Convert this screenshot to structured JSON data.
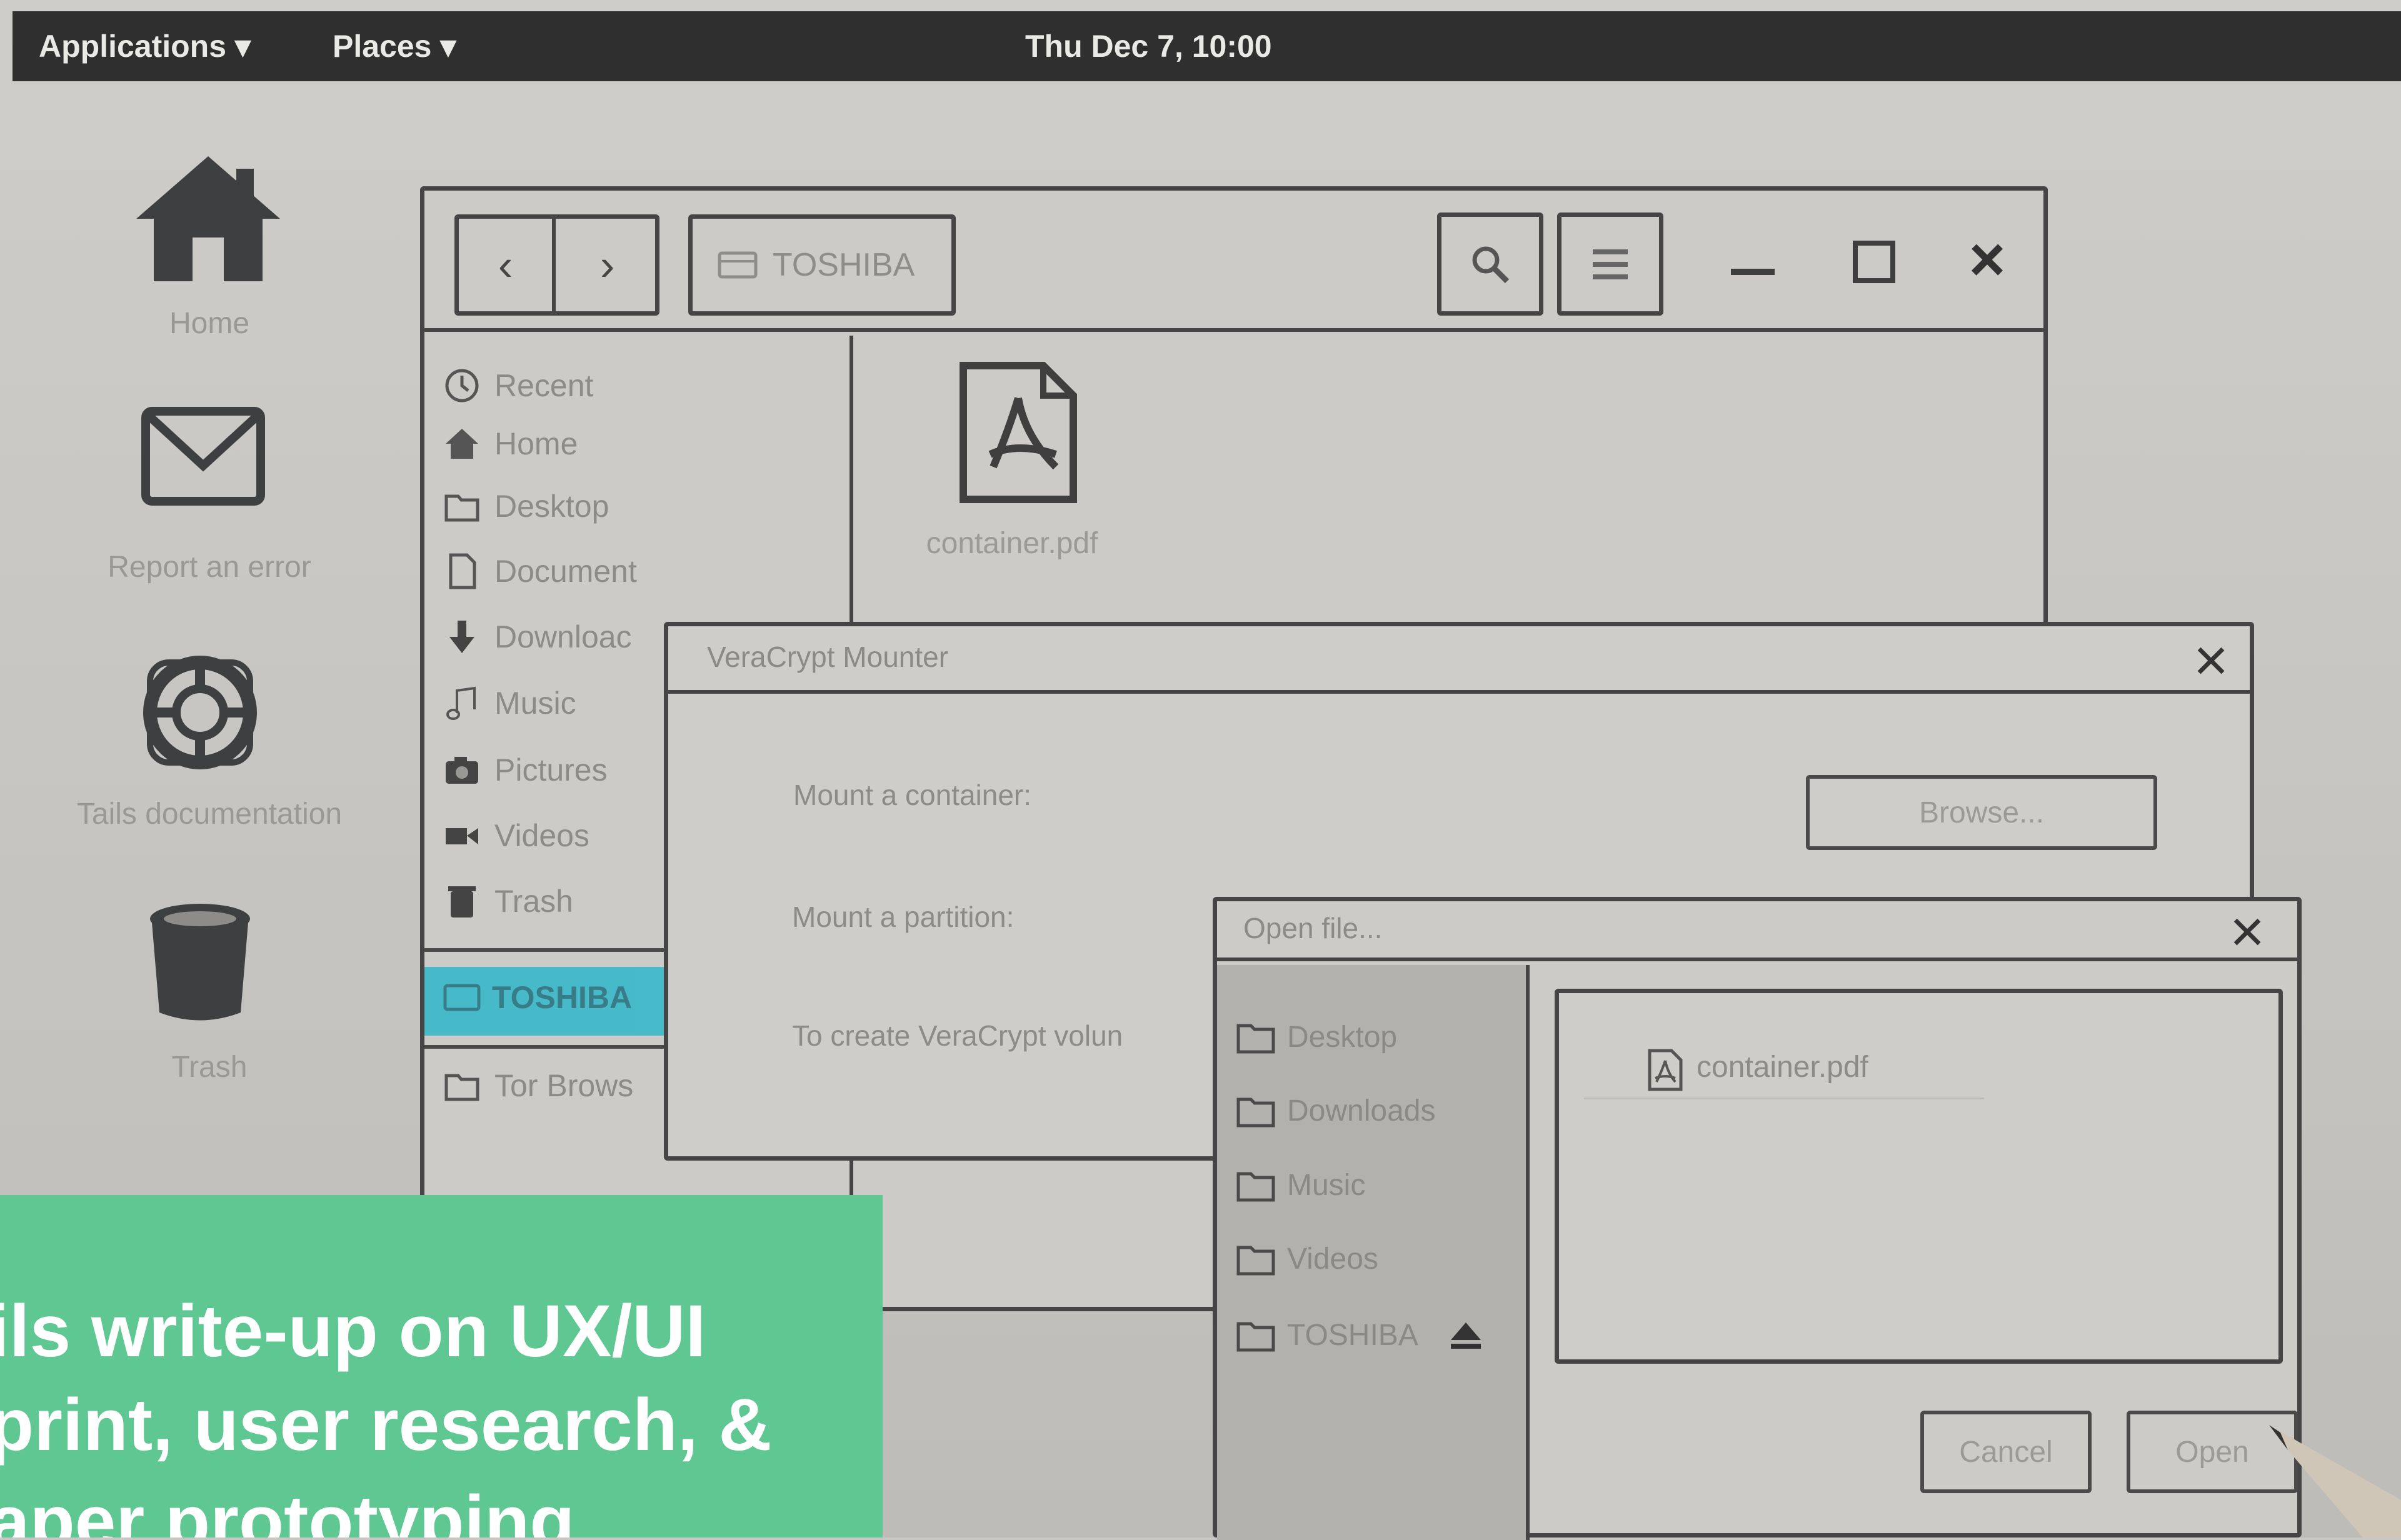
{
  "topbar": {
    "applications": "Applications",
    "places": "Places",
    "clock": "Thu Dec 7, 10:00"
  },
  "desktop": {
    "icons": [
      {
        "label": "Home",
        "icon": "home-icon"
      },
      {
        "label": "Report an error",
        "icon": "envelope-icon"
      },
      {
        "label": "Tails documentation",
        "icon": "lifebuoy-icon"
      },
      {
        "label": "Trash",
        "icon": "trash-icon"
      }
    ]
  },
  "file_manager": {
    "location": "TOSHIBA",
    "sidebar": [
      {
        "label": "Recent",
        "icon": "clock-icon"
      },
      {
        "label": "Home",
        "icon": "home-icon"
      },
      {
        "label": "Desktop",
        "icon": "folder-icon"
      },
      {
        "label": "Document",
        "icon": "document-icon"
      },
      {
        "label": "Downloac",
        "icon": "download-icon"
      },
      {
        "label": "Music",
        "icon": "music-icon"
      },
      {
        "label": "Pictures",
        "icon": "camera-icon"
      },
      {
        "label": "Videos",
        "icon": "video-icon"
      },
      {
        "label": "Trash",
        "icon": "trash-icon"
      }
    ],
    "drive": "TOSHIBA",
    "tor_item": "Tor Brows",
    "file": "container.pdf"
  },
  "veracrypt": {
    "title": "VeraCrypt Mounter",
    "mount_container": "Mount a container:",
    "browse": "Browse...",
    "mount_partition": "Mount a partition:",
    "create_text": "To create VeraCrypt volun"
  },
  "open_file": {
    "title": "Open file...",
    "places": [
      "Desktop",
      "Downloads",
      "Music",
      "Videos",
      "TOSHIBA"
    ],
    "file": "container.pdf",
    "cancel": "Cancel",
    "open": "Open"
  },
  "banner": {
    "lines": [
      "ils write-up on UX/UI",
      "print, user research, &",
      "aper prototyping"
    ]
  },
  "colors": {
    "banner": "#5ec792",
    "highlight": "#2fb8c9",
    "topbar": "#2e2f2e"
  }
}
